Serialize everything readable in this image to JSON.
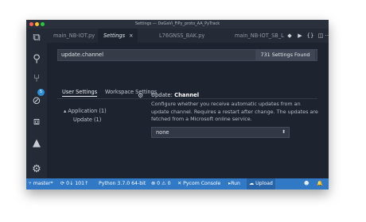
{
  "window": {
    "title": "Settings — DeGaVi_FiPy_proto_AA_PyTrack"
  },
  "colors": {
    "accent": "#3279c5",
    "background": "#1e2330",
    "sidebar": "#252b36",
    "badge": "#2d8fd5"
  },
  "activity_bar": {
    "items": [
      {
        "icon": "files-icon",
        "glyph": "⧉"
      },
      {
        "icon": "search-icon",
        "glyph": "⚲"
      },
      {
        "icon": "source-control-icon",
        "glyph": "⑂",
        "badge": "5"
      },
      {
        "icon": "no-bugs-icon",
        "glyph": "⊘"
      },
      {
        "icon": "extensions-icon",
        "glyph": "⧈"
      },
      {
        "icon": "azure-icon",
        "glyph": "▲"
      },
      {
        "icon": "gear-icon",
        "glyph": "⚙"
      }
    ]
  },
  "tabs": [
    {
      "label": "main_NB-IOT.py",
      "active": false
    },
    {
      "label": "Settings",
      "active": true,
      "close": "×"
    },
    {
      "label": "L76GNSS_BAK.py",
      "active": false
    },
    {
      "label": "main_NB-IOT_SB_L",
      "active": false
    }
  ],
  "tab_actions": [
    "◆",
    "▶",
    "{}",
    "◫",
    "···"
  ],
  "search": {
    "value": "update.channel",
    "count": "731 Settings Found"
  },
  "settings_tabs": {
    "user": "User Settings",
    "workspace": "Workspace Settings"
  },
  "tree": {
    "parent": "Application (1)",
    "child": "Update (1)"
  },
  "setting": {
    "category": "Update:",
    "name": "Channel",
    "description": "Configure whether you receive automatic updates from an update channel. Requires a restart after change. The updates are fetched from a Microsoft online service.",
    "value": "none"
  },
  "statusbar": {
    "branch": "master*",
    "sync": "0↓ 101↑",
    "python": "Python 3.7.0 64-bit",
    "problems": "⊗ 0 ⚠ 0",
    "pycom": "✕ Pycom Console",
    "run": "▸Run",
    "upload": "☁ Upload",
    "smiley": "☻",
    "bell": "🔔"
  }
}
